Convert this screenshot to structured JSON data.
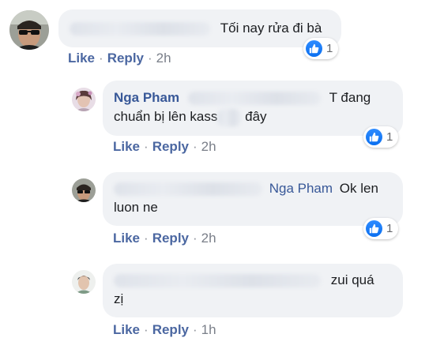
{
  "comments": [
    {
      "text": "Tối nay rửa đi bà",
      "actions": {
        "like": "Like",
        "reply": "Reply",
        "time": "2h"
      },
      "reaction_count": "1"
    },
    {
      "author": "Nga Pham",
      "text_a": "T đang",
      "text_b": "chuẩn bị lên kass",
      "text_c": "đây",
      "actions": {
        "like": "Like",
        "reply": "Reply",
        "time": "2h"
      },
      "reaction_count": "1"
    },
    {
      "mention": "Nga Pham",
      "text_a": "Ok len",
      "text_b": "luon ne",
      "actions": {
        "like": "Like",
        "reply": "Reply",
        "time": "2h"
      },
      "reaction_count": "1"
    },
    {
      "text_a": "zui quá",
      "text_b": "zị",
      "actions": {
        "like": "Like",
        "reply": "Reply",
        "time": "1h"
      }
    }
  ],
  "colors": {
    "link": "#4b67a1",
    "author": "#385898",
    "bubble": "#f0f2f5",
    "like_blue": "#1877f2"
  },
  "separator": "·"
}
